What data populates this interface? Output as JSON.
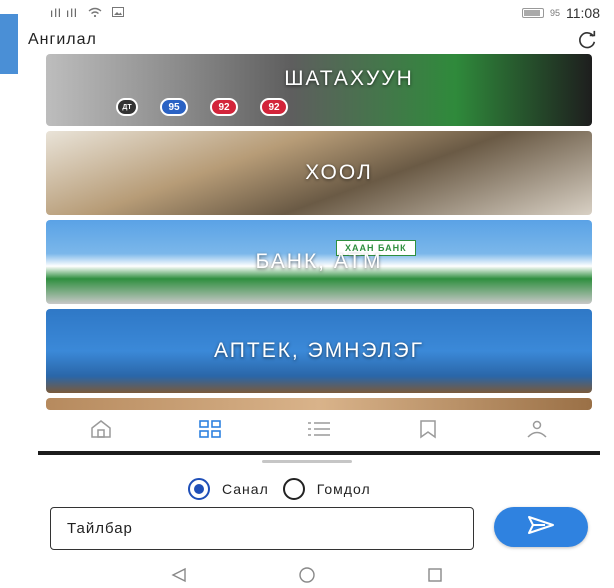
{
  "status_bar": {
    "signal": "ıll ıll",
    "wifi_icon": "wifi-icon",
    "image_icon": "image-icon",
    "battery": "95",
    "time": "11:08"
  },
  "app_bar": {
    "title": "Ангилал",
    "refresh_icon": "refresh-icon"
  },
  "categories": [
    {
      "label": "ШАТАХУУН",
      "badges": [
        "ДТ",
        "95",
        "92",
        "92"
      ]
    },
    {
      "label": "ХООЛ"
    },
    {
      "label": "БАНК, АТМ",
      "sign": "ХААН БАНК"
    },
    {
      "label": "АПТЕК, ЭМНЭЛЭГ"
    }
  ],
  "bottom_nav": {
    "items": [
      {
        "icon": "home-icon"
      },
      {
        "icon": "grid-icon",
        "active": true
      },
      {
        "icon": "list-icon"
      },
      {
        "icon": "bookmark-icon"
      },
      {
        "icon": "user-icon"
      }
    ],
    "active_color": "#2f82e0",
    "inactive_color": "#9a9a9a"
  },
  "feedback": {
    "options": [
      {
        "label": "Санал",
        "checked": true
      },
      {
        "label": "Гомдол",
        "checked": false
      }
    ],
    "input_value": "Тайлбар",
    "send_icon": "send-icon",
    "accent_color": "#2f82e0"
  },
  "system_nav": {
    "items": [
      "back-icon",
      "home-circle-icon",
      "recents-icon"
    ]
  }
}
